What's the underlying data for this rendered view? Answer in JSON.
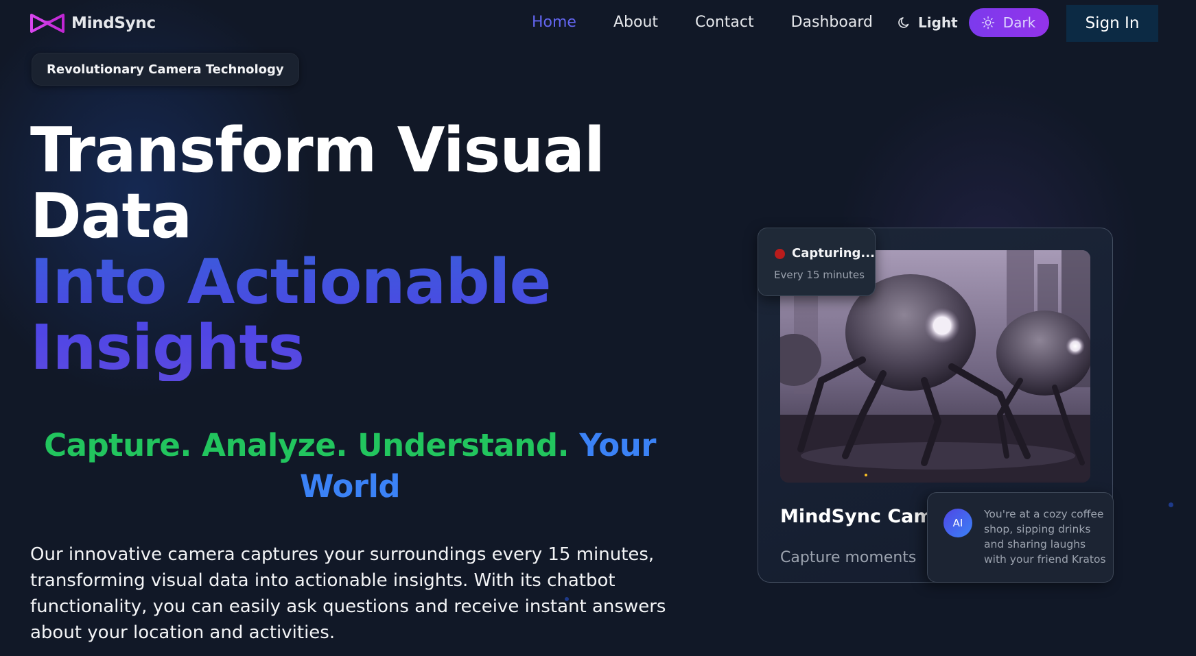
{
  "nav": {
    "brand": "MindSync",
    "links": [
      {
        "label": "Home",
        "active": true
      },
      {
        "label": "About",
        "active": false
      },
      {
        "label": "Contact",
        "active": false
      },
      {
        "label": "Dashboard",
        "active": false
      }
    ],
    "theme": {
      "light_label": "Light",
      "dark_label": "Dark",
      "selected": "Dark"
    },
    "signin_label": "Sign In"
  },
  "hero": {
    "badge": "Revolutionary Camera Technology",
    "title_line1": "Transform Visual Data",
    "title_line2": "Into Actionable Insights",
    "tagline": {
      "part_green": "Capture. Analyze. Understand.",
      "part_blue": "Your World"
    },
    "description": "Our innovative camera captures your surroundings every 15 minutes, transforming visual data into actionable insights. With its chatbot functionality, you can easily ask questions and receive instant answers about your location and activities."
  },
  "card": {
    "capture_status": "Capturing...",
    "capture_interval": "Every 15 minutes",
    "title": "MindSync Camer",
    "subtitle": "Capture moments",
    "ai_avatar": "AI",
    "ai_message": "You're at a cozy coffee shop, sipping drinks and sharing laughs with your friend Kratos"
  },
  "colors": {
    "background": "#111827",
    "active_link": "#6366f1",
    "dark_toggle": "#7c3aed",
    "signin_bg": "#0c2a44",
    "tagline_green": "#22c55e",
    "tagline_blue": "#3b82f6",
    "title_gradient": "#3b5bdb",
    "record_dot": "#b91c1c"
  },
  "icons": {
    "logo": "infinity-bowtie-logo-icon",
    "light": "moon-icon",
    "dark": "sun-icon"
  }
}
